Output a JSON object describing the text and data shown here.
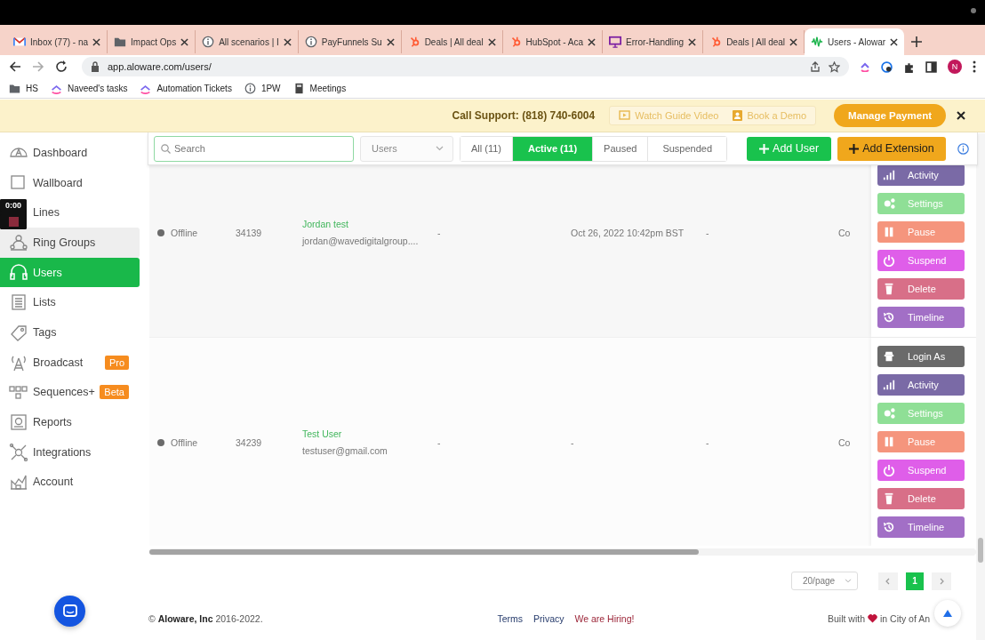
{
  "browser": {
    "tabs": [
      {
        "title": "Inbox (77) - na",
        "kind": "mail",
        "selected": false
      },
      {
        "title": "Impact Ops",
        "kind": "folder",
        "selected": false
      },
      {
        "title": "All scenarios | I",
        "kind": "info",
        "selected": false
      },
      {
        "title": "PayFunnels Su",
        "kind": "info",
        "selected": false
      },
      {
        "title": "Deals | All deal",
        "kind": "hubspot",
        "selected": false
      },
      {
        "title": "HubSpot - Aca",
        "kind": "hubspot",
        "selected": false
      },
      {
        "title": "Error-Handling",
        "kind": "slides",
        "selected": false
      },
      {
        "title": "Deals | All deal",
        "kind": "hubspot",
        "selected": false
      },
      {
        "title": "Users - Alowar",
        "kind": "wave",
        "selected": true
      }
    ],
    "url": "app.aloware.com/users/",
    "profile": "N",
    "bookmarks": [
      {
        "label": "HS",
        "kind": "folder"
      },
      {
        "label": "Naveed's tasks",
        "kind": "clickup"
      },
      {
        "label": "Automation Tickets",
        "kind": "clickup"
      },
      {
        "label": "1PW",
        "kind": "info"
      },
      {
        "label": "Meetings",
        "kind": "notebook"
      }
    ]
  },
  "banner": {
    "support": "Call Support: (818) 740-6004",
    "links": [
      {
        "label": "Watch Guide Video",
        "kind": "video"
      },
      {
        "label": "Book a Demo",
        "kind": "contact"
      }
    ],
    "button": "Manage Payment"
  },
  "sidebar": {
    "items": [
      {
        "label": "Dashboard",
        "kind": "dashboard",
        "selected": false,
        "highlighted": false
      },
      {
        "label": "Wallboard",
        "kind": "square",
        "selected": false,
        "highlighted": false
      },
      {
        "label": "Lines",
        "kind": "lines",
        "selected": false,
        "highlighted": false
      },
      {
        "label": "Ring Groups",
        "kind": "group",
        "selected": false,
        "highlighted": true
      },
      {
        "label": "Users",
        "kind": "headset",
        "selected": true,
        "highlighted": false
      },
      {
        "label": "Lists",
        "kind": "list",
        "selected": false,
        "highlighted": false
      },
      {
        "label": "Tags",
        "kind": "tag",
        "selected": false,
        "highlighted": false
      },
      {
        "label": "Broadcast",
        "kind": "tower",
        "badge": "Pro",
        "selected": false,
        "highlighted": false
      },
      {
        "label": "Sequences+",
        "kind": "sequence",
        "badge": "Beta",
        "selected": false,
        "highlighted": false
      },
      {
        "label": "Reports",
        "kind": "report",
        "selected": false,
        "highlighted": false
      },
      {
        "label": "Integrations",
        "kind": "hub",
        "selected": false,
        "highlighted": false
      },
      {
        "label": "Account",
        "kind": "chart",
        "selected": false,
        "highlighted": false
      }
    ]
  },
  "recorder": {
    "time": "0:00"
  },
  "toolbar": {
    "search": {
      "placeholder": "Search"
    },
    "user_type": "Users",
    "filters": [
      {
        "label": "All (11)",
        "selected": false
      },
      {
        "label": "Active (11)",
        "selected": true
      },
      {
        "label": "Paused",
        "selected": false
      },
      {
        "label": "Suspended",
        "selected": false
      }
    ],
    "buttons": [
      {
        "label": "Add User",
        "kind": "green"
      },
      {
        "label": "Add Extension",
        "kind": "orange"
      }
    ]
  },
  "table": {
    "rows": [
      {
        "status": "Offline",
        "extension": "34139",
        "name": "Jordan test",
        "email": "jordan@wavedigitalgroup....",
        "column_5": "-",
        "column_6": "Oct 26, 2022 10:42pm BST",
        "column_7": "-",
        "column_8": "Co",
        "actions": [
          {
            "label": "Activity",
            "kind": "activity"
          },
          {
            "label": "Settings",
            "kind": "settings"
          },
          {
            "label": "Pause",
            "kind": "pause"
          },
          {
            "label": "Suspend",
            "kind": "suspend"
          },
          {
            "label": "Delete",
            "kind": "delete"
          },
          {
            "label": "Timeline",
            "kind": "timeline"
          }
        ]
      },
      {
        "status": "Offline",
        "extension": "34239",
        "name": "Test User",
        "email": "testuser@gmail.com",
        "column_5": "-",
        "column_6": "-",
        "column_7": "-",
        "column_8": "Co",
        "actions": [
          {
            "label": "Login As",
            "kind": "login"
          },
          {
            "label": "Activity",
            "kind": "activity"
          },
          {
            "label": "Settings",
            "kind": "settings"
          },
          {
            "label": "Pause",
            "kind": "pause"
          },
          {
            "label": "Suspend",
            "kind": "suspend"
          },
          {
            "label": "Delete",
            "kind": "delete"
          },
          {
            "label": "Timeline",
            "kind": "timeline"
          }
        ]
      }
    ]
  },
  "pagination": {
    "page_size": "20/page",
    "pages": [
      {
        "label": "1",
        "selected": true
      }
    ]
  },
  "footer": {
    "copyright": "© **Aloware, Inc** 2016-2022.",
    "links": [
      {
        "label": "Terms",
        "kind": "plain"
      },
      {
        "label": "Privacy",
        "kind": "plain"
      },
      {
        "label": "We are Hiring!",
        "kind": "accent"
      }
    ],
    "built_with": "Built with",
    "location": "in City of An"
  }
}
